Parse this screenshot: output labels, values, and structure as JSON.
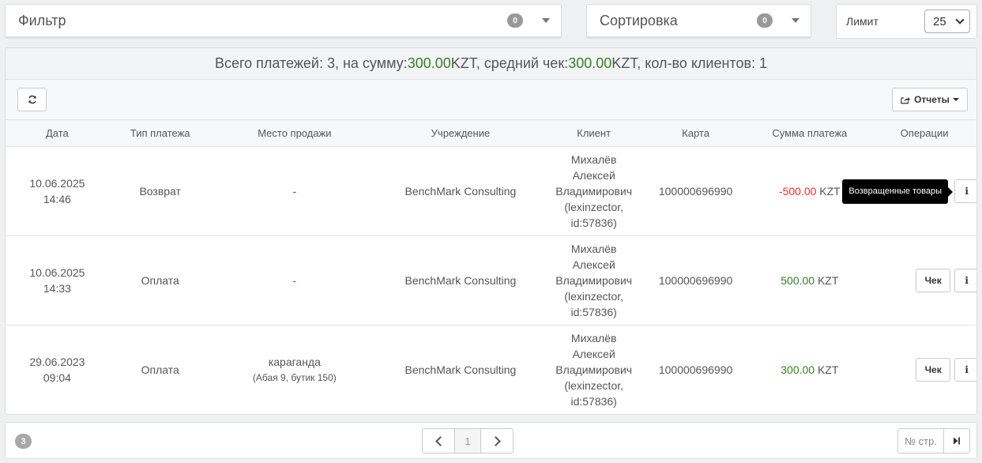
{
  "filter": {
    "title": "Фильтр",
    "badge": "0"
  },
  "sort": {
    "title": "Сортировка",
    "badge": "0"
  },
  "limit": {
    "label": "Лимит",
    "value": "25"
  },
  "summary": {
    "prefix": "Всего платежей: 3, на сумму: ",
    "total": "300.00",
    "mid": " KZT, средний чек: ",
    "avg": "300.00",
    "suffix": " KZT, кол-во клиентов: 1"
  },
  "toolbar": {
    "reports_label": "Отчеты",
    "refresh_icon": "refresh-icon",
    "reports_icon": "share-icon"
  },
  "table": {
    "headers": [
      "Дата",
      "Тип платежа",
      "Место продажи",
      "Учреждение",
      "Клиент",
      "Карта",
      "Сумма платежа",
      "Операции"
    ],
    "rows": [
      {
        "date": "10.06.2025",
        "time": "14:46",
        "type": "Возврат",
        "place": "-",
        "place_sub": "",
        "org": "BenchMark Consulting",
        "client_l1": "Михалёв",
        "client_l2": "Алексей",
        "client_l3": "Владимирович",
        "client_l4": "(lexinzector,",
        "client_l5": "id:57836)",
        "card": "100000696990",
        "amount": "-500.00",
        "currency": " KZT",
        "tooltip": "Возвращенные товары"
      },
      {
        "date": "10.06.2025",
        "time": "14:33",
        "type": "Оплата",
        "place": "-",
        "place_sub": "",
        "org": "BenchMark Consulting",
        "client_l1": "Михалёв",
        "client_l2": "Алексей",
        "client_l3": "Владимирович",
        "client_l4": "(lexinzector,",
        "client_l5": "id:57836)",
        "card": "100000696990",
        "amount": "500.00",
        "currency": " KZT",
        "check_label": "Чек"
      },
      {
        "date": "29.06.2023",
        "time": "09:04",
        "type": "Оплата",
        "place": "караганда",
        "place_sub": "(Абая 9, бутик 150)",
        "org": "BenchMark Consulting",
        "client_l1": "Михалёв",
        "client_l2": "Алексей",
        "client_l3": "Владимирович",
        "client_l4": "(lexinzector,",
        "client_l5": "id:57836)",
        "card": "100000696990",
        "amount": "300.00",
        "currency": " KZT",
        "check_label": "Чек"
      }
    ],
    "info_label": "i"
  },
  "footer": {
    "count": "3",
    "page": "1",
    "goto_placeholder": "№ стр."
  },
  "colors": {
    "positive": "#3a7d27",
    "negative": "#e0322f"
  }
}
